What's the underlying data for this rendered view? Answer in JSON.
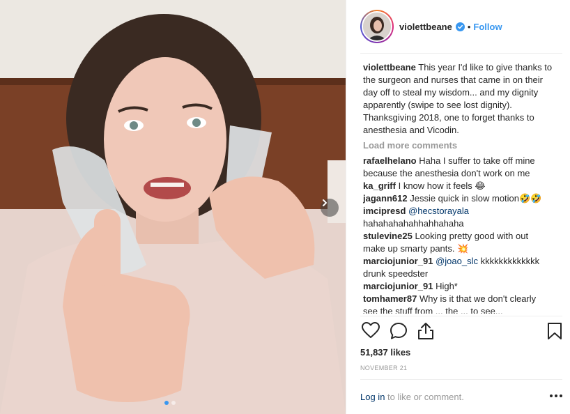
{
  "header": {
    "username": "violettbeane",
    "separator": "•",
    "follow_label": "Follow"
  },
  "caption": {
    "user": "violettbeane",
    "text": "This year I'd like to give thanks to the surgeon and nurses that came in on their day off to steal my wisdom... and my dignity apparently (swipe to see lost dignity). Thanksgiving 2018, one to forget thanks to anesthesia and Vicodin."
  },
  "load_more": "Load more comments",
  "comments": [
    {
      "user": "rafaelhelano",
      "text": "Haha I suffer to take off mine because the anesthesia don't work on me"
    },
    {
      "user": "ka_griff",
      "text": "I know how it feels 😂"
    },
    {
      "user": "jagann612",
      "text": "Jessie quick in slow motion🤣🤣"
    },
    {
      "user": "imcipresd",
      "mention": "@hecstorayala",
      "text": "hahahahahahhahhahaha"
    },
    {
      "user": "stulevine25",
      "text": "Looking pretty good with out make up smarty pants. 💥"
    },
    {
      "user": "marciojunior_91",
      "mention": "@joao_slc",
      "text": "kkkkkkkkkkkkk drunk speedster"
    },
    {
      "user": "marciojunior_91",
      "text": "High*"
    },
    {
      "user": "tomhamer87",
      "text": "Why is it that we don't clearly see the stuff from ... the ... to see..."
    }
  ],
  "likes": "51,837 likes",
  "date": "NOVEMBER 21",
  "login": {
    "link": "Log in",
    "rest": " to like or comment."
  },
  "icons": {
    "heart": "heart-icon",
    "comment": "comment-icon",
    "share": "share-icon",
    "bookmark": "bookmark-icon",
    "verified": "verified-badge-icon",
    "next": "chevron-right-icon",
    "more": "more-options-icon"
  },
  "colors": {
    "accent": "#3897f0",
    "link_dark": "#003569",
    "muted": "#999999",
    "text": "#262626"
  }
}
